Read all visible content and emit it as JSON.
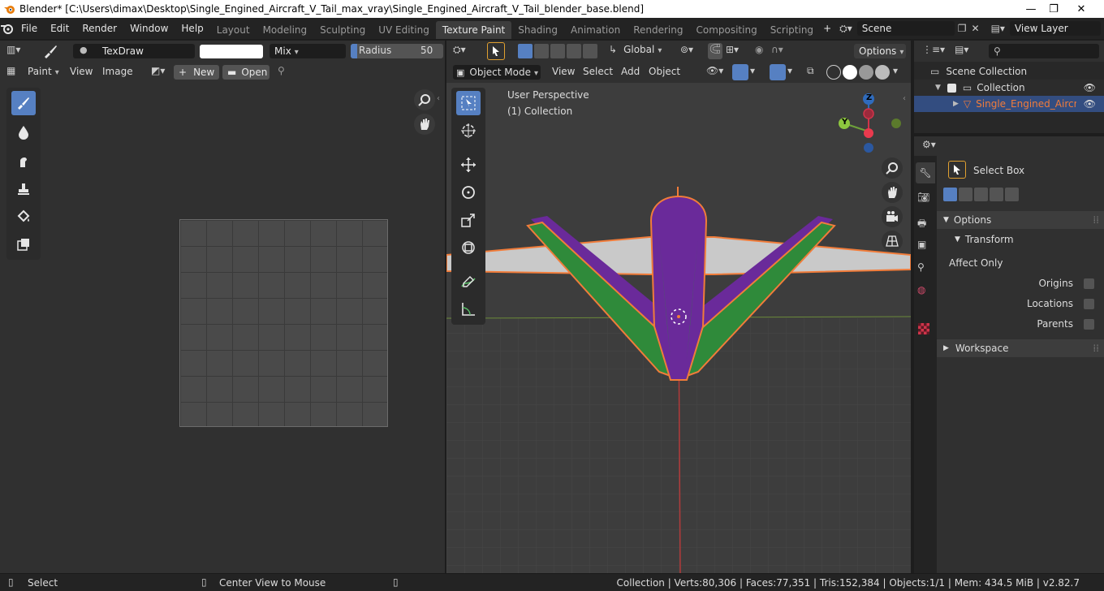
{
  "titlebar": {
    "title": "Blender* [C:\\Users\\dimax\\Desktop\\Single_Engined_Aircraft_V_Tail_max_vray\\Single_Engined_Aircraft_V_Tail_blender_base.blend]"
  },
  "menu": {
    "items": [
      "File",
      "Edit",
      "Render",
      "Window",
      "Help"
    ]
  },
  "workspaces": [
    "Layout",
    "Modeling",
    "Sculpting",
    "UV Editing",
    "Texture Paint",
    "Shading",
    "Animation",
    "Rendering",
    "Compositing",
    "Scripting"
  ],
  "active_workspace": "Texture Paint",
  "scene": {
    "name": "Scene",
    "view_layer": "View Layer"
  },
  "image_editor": {
    "brush_name": "TexDraw",
    "blend_mode": "Mix",
    "radius_label": "Radius",
    "radius_value": "50 px",
    "mode": "Paint",
    "menus": [
      "View",
      "Image"
    ],
    "new_label": "New",
    "open_label": "Open"
  },
  "viewport": {
    "mode": "Object Mode",
    "menus": [
      "View",
      "Select",
      "Add",
      "Object"
    ],
    "orientation": "Global",
    "options_label": "Options",
    "overlay_title": "User Perspective",
    "overlay_subtitle": "(1) Collection",
    "gizmo": {
      "z": "Z",
      "y": "Y"
    }
  },
  "outliner": {
    "scene_collection": "Scene Collection",
    "collection": "Collection",
    "object": "Single_Engined_Aircraft_"
  },
  "properties": {
    "tool_name": "Select Box",
    "options_label": "Options",
    "transform_label": "Transform",
    "affect_only_label": "Affect Only",
    "origins_label": "Origins",
    "locations_label": "Locations",
    "parents_label": "Parents",
    "workspace_label": "Workspace"
  },
  "statusbar": {
    "select": "Select",
    "center_view": "Center View to Mouse",
    "stats": "Collection | Verts:80,306 | Faces:77,351 | Tris:152,384 | Objects:1/1 | Mem: 434.5 MiB | v2.82.7"
  },
  "colors": {
    "accent": "#5680c2",
    "selected_object": "#f17c3a",
    "active_tab": "#3d3d3d"
  }
}
